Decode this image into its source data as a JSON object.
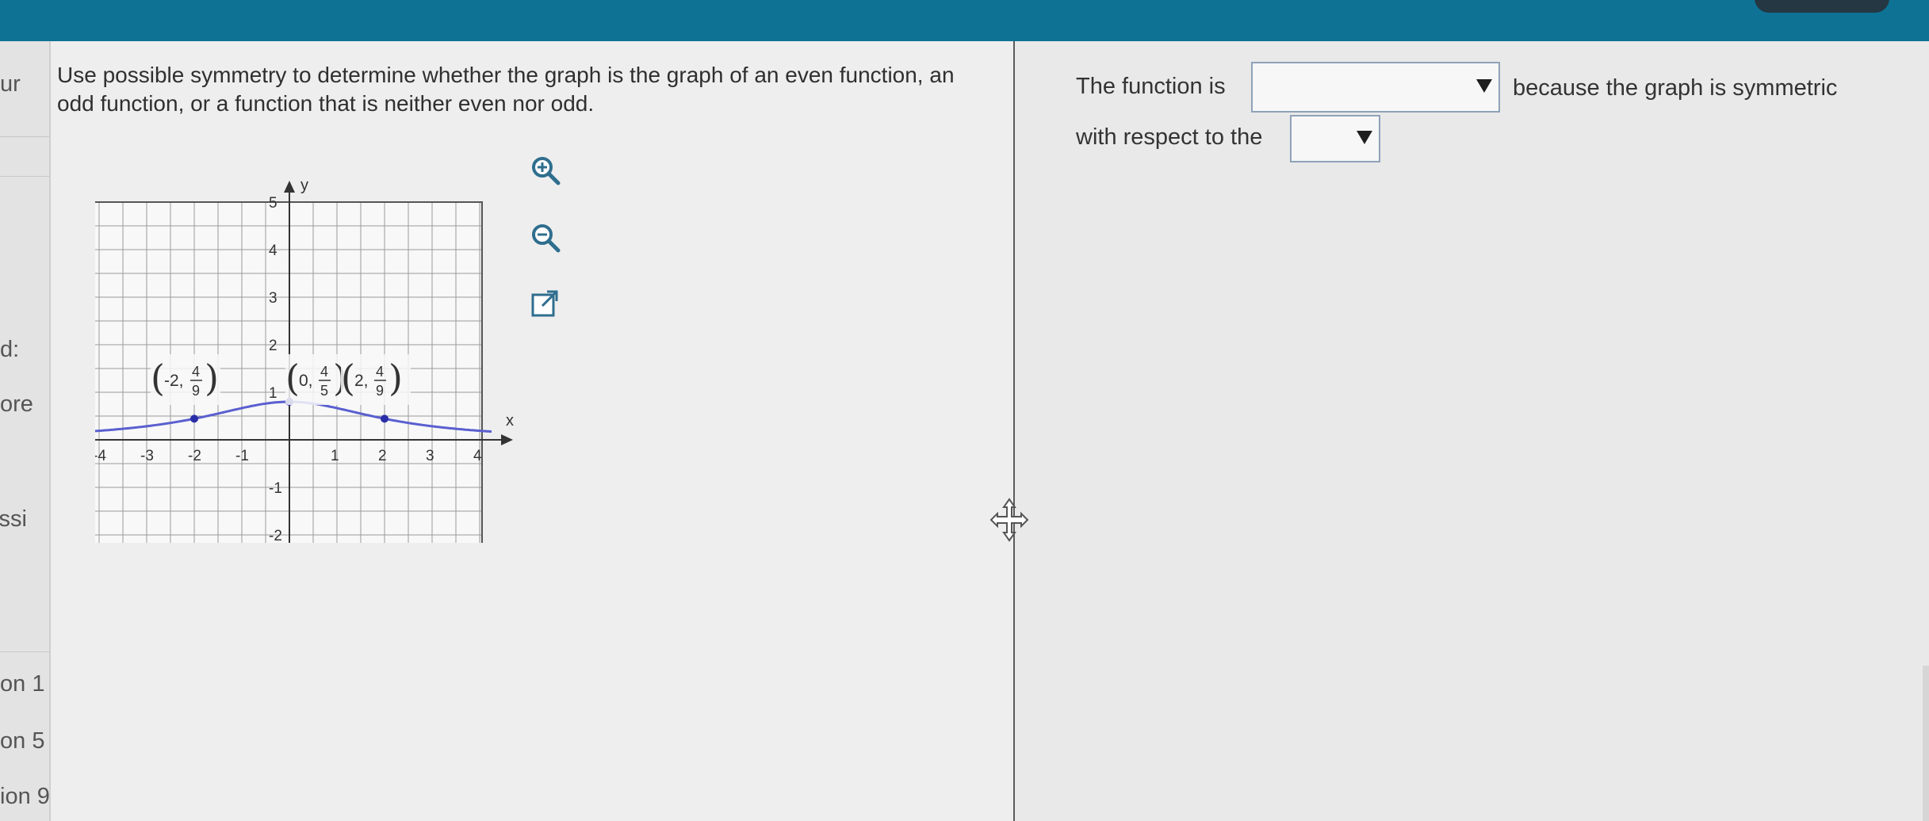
{
  "left_strip": {
    "items": [
      "ur",
      "d:",
      "ore",
      "issi",
      "on 1",
      "on 5",
      "ion 9"
    ]
  },
  "question": {
    "text": "Use possible symmetry to determine whether the graph is the graph of an even function, an odd function, or a function that is neither even nor odd."
  },
  "graph": {
    "axis_x_label": "x",
    "axis_y_label": "y",
    "x_ticks": [
      "-4",
      "-3",
      "-2",
      "-1",
      "1",
      "2",
      "3",
      "4"
    ],
    "y_ticks": [
      "5",
      "4",
      "3",
      "2",
      "1",
      "-1",
      "-2"
    ],
    "points": [
      {
        "x": -2,
        "y": 0.444,
        "label_x": "-2",
        "label_num": "4",
        "label_den": "9"
      },
      {
        "x": 0,
        "y": 0.8,
        "label_x": "0",
        "label_num": "4",
        "label_den": "5"
      },
      {
        "x": 2,
        "y": 0.444,
        "label_x": "2",
        "label_num": "4",
        "label_den": "9"
      }
    ],
    "curve_color": "#5a5fd0",
    "point_color": "#2a2ea8"
  },
  "tools": {
    "zoom_in": "zoom-in-icon",
    "zoom_out": "zoom-out-icon",
    "popout": "external-link-icon"
  },
  "answer": {
    "part1": "The function is",
    "part2": "because the graph is symmetric",
    "part3": "with respect to the",
    "dropdown1_value": "",
    "dropdown2_value": ""
  }
}
